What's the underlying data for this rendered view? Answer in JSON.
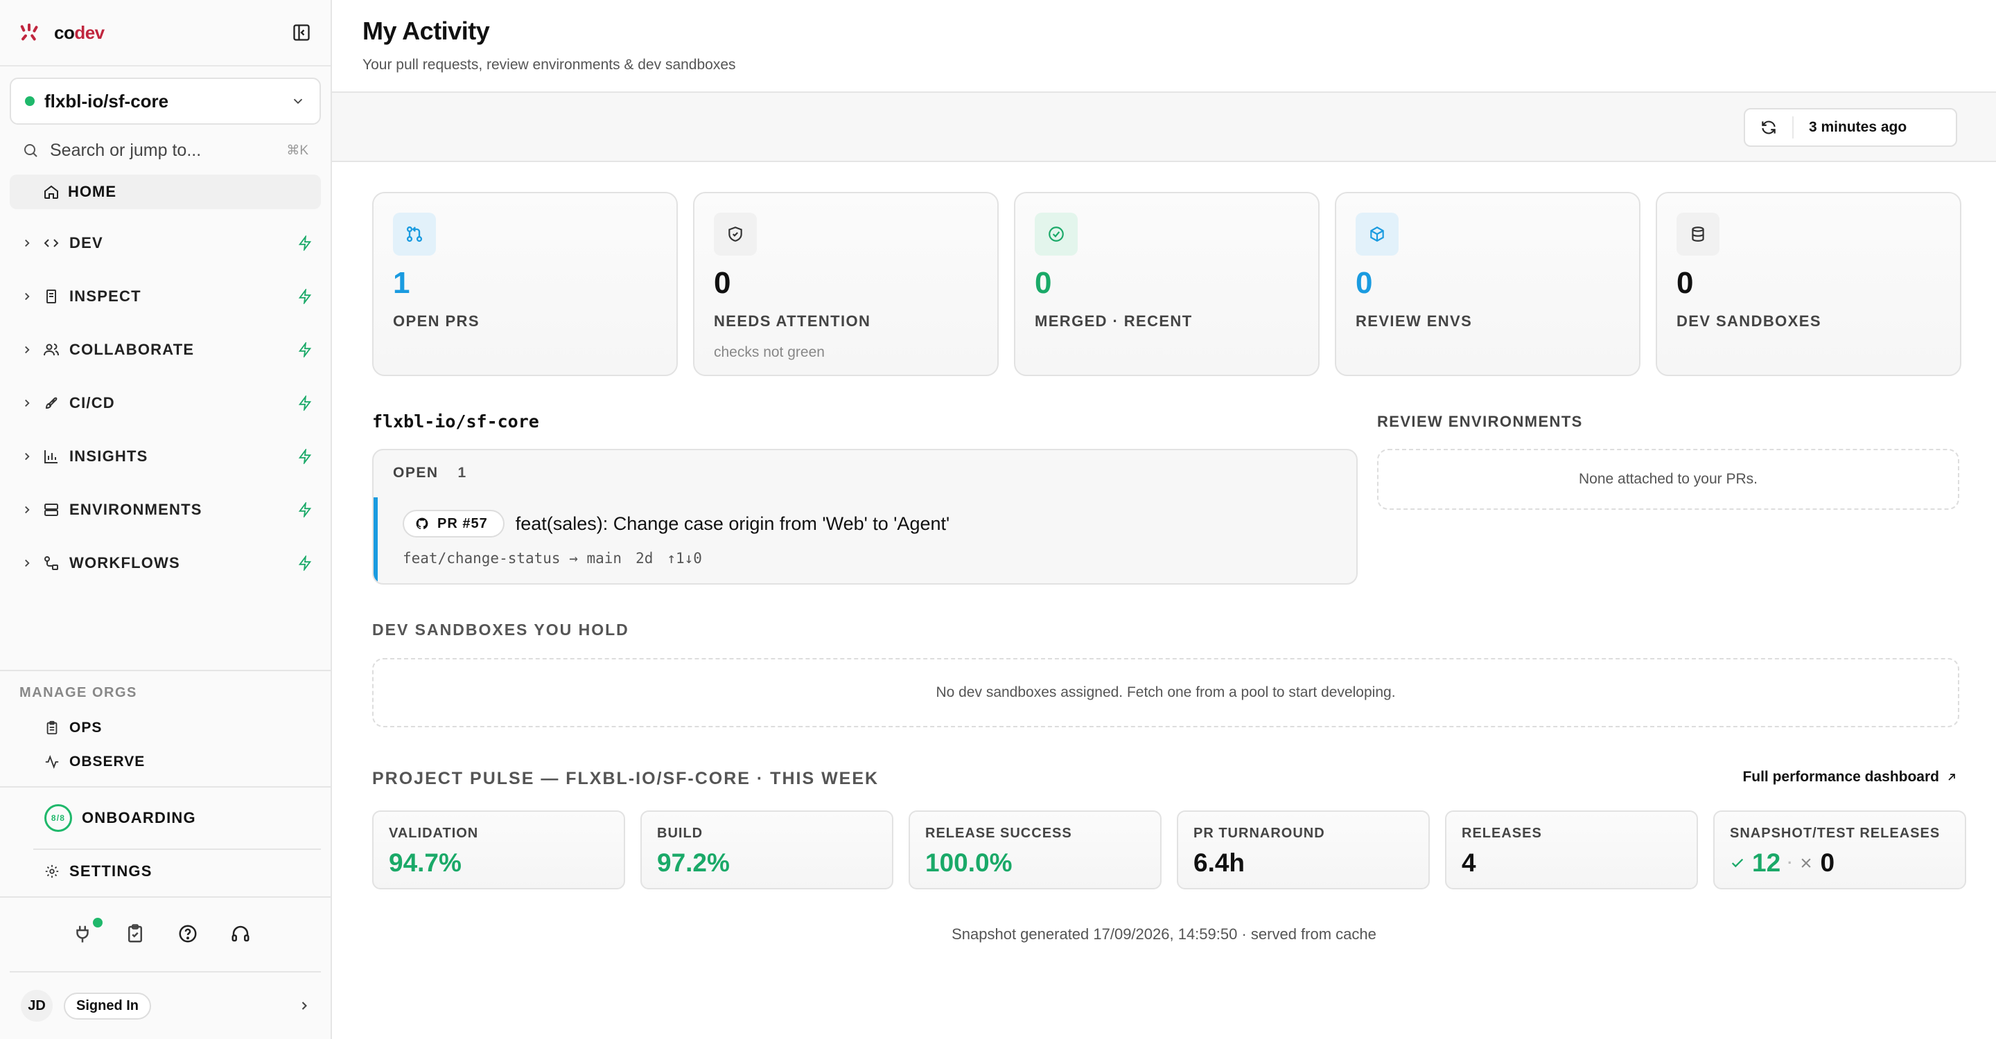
{
  "brand": {
    "prefix": "co",
    "suffix": "dev",
    "accent": "#c0263e"
  },
  "org_selector": {
    "name": "flxbl-io/sf-core",
    "status_color": "#1fb86b"
  },
  "search": {
    "placeholder": "Search or jump to...",
    "shortcut": "⌘K"
  },
  "nav": {
    "home": "HOME",
    "items": [
      {
        "label": "DEV",
        "icon": "code-icon"
      },
      {
        "label": "INSPECT",
        "icon": "file-icon"
      },
      {
        "label": "COLLABORATE",
        "icon": "users-icon"
      },
      {
        "label": "CI/CD",
        "icon": "rocket-icon"
      },
      {
        "label": "INSIGHTS",
        "icon": "bar-chart-icon"
      },
      {
        "label": "ENVIRONMENTS",
        "icon": "server-icon"
      },
      {
        "label": "WORKFLOWS",
        "icon": "workflow-icon"
      }
    ]
  },
  "manage_orgs": {
    "header": "MANAGE ORGS",
    "items": [
      "OPS",
      "OBSERVE"
    ]
  },
  "onboarding": {
    "label": "ONBOARDING",
    "progress": "8/8"
  },
  "settings": {
    "label": "SETTINGS"
  },
  "user": {
    "initials": "JD",
    "status": "Signed In"
  },
  "page": {
    "title": "My Activity",
    "subtitle": "Your pull requests, review environments & dev sandboxes"
  },
  "refresh": {
    "label": "3 minutes ago"
  },
  "stats": [
    {
      "value": "1",
      "label": "OPEN PRS",
      "note": "",
      "color": "#1a9be0"
    },
    {
      "value": "0",
      "label": "NEEDS ATTENTION",
      "note": "checks not green",
      "color": "#111111"
    },
    {
      "value": "0",
      "label": "MERGED · RECENT",
      "note": "",
      "color": "#1aa968"
    },
    {
      "value": "0",
      "label": "REVIEW ENVS",
      "note": "",
      "color": "#1a9be0"
    },
    {
      "value": "0",
      "label": "DEV SANDBOXES",
      "note": "",
      "color": "#111111"
    }
  ],
  "repo": {
    "name": "flxbl-io/sf-core",
    "open_label": "OPEN",
    "open_count": "1",
    "pr": {
      "number": "PR #57",
      "title": "feat(sales): Change case origin from 'Web' to 'Agent'",
      "branch": "feat/change-status → main",
      "age": "2d",
      "diff": "↑1↓0"
    }
  },
  "review_envs": {
    "title": "REVIEW ENVIRONMENTS",
    "empty": "None attached to your PRs."
  },
  "dev_sandboxes": {
    "title": "DEV SANDBOXES YOU HOLD",
    "empty": "No dev sandboxes assigned. Fetch one from a pool to start developing."
  },
  "pulse": {
    "title": "PROJECT PULSE — FLXBL-IO/SF-CORE · THIS WEEK",
    "link": "Full performance dashboard",
    "metrics": [
      {
        "label": "VALIDATION",
        "value": "94.7%"
      },
      {
        "label": "BUILD",
        "value": "97.2%"
      },
      {
        "label": "RELEASE SUCCESS",
        "value": "100.0%"
      },
      {
        "label": "PR TURNAROUND",
        "value": "6.4h"
      },
      {
        "label": "RELEASES",
        "value": "4"
      },
      {
        "label": "SNAPSHOT/TEST RELEASES",
        "ok": "12",
        "separator": "·",
        "failed": "0"
      }
    ]
  },
  "footer": "Snapshot generated 17/09/2026, 14:59:50 · served from cache"
}
